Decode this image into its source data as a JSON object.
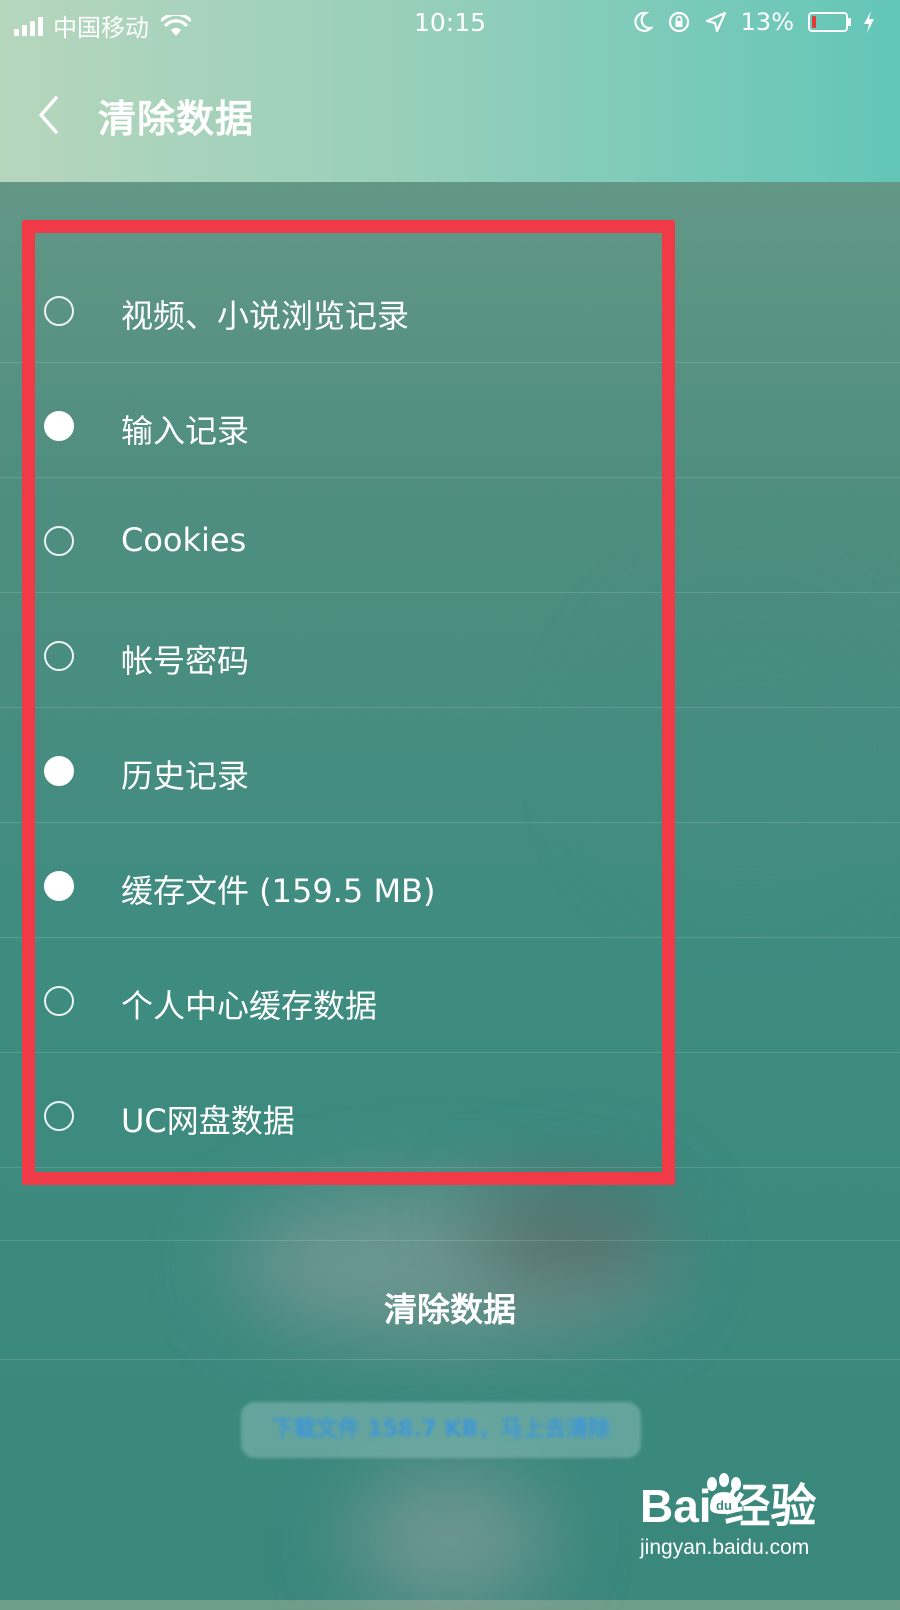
{
  "status_bar": {
    "carrier": "中国移动",
    "time": "10:15",
    "battery_percent": "13%",
    "battery_level": 0.13
  },
  "header": {
    "title": "清除数据"
  },
  "options": [
    {
      "label": "视频、小说浏览记录",
      "checked": false
    },
    {
      "label": "输入记录",
      "checked": true
    },
    {
      "label": "Cookies",
      "checked": false
    },
    {
      "label": "帐号密码",
      "checked": false
    },
    {
      "label": "历史记录",
      "checked": true
    },
    {
      "label": "缓存文件 (159.5 MB)",
      "checked": true
    },
    {
      "label": "个人中心缓存数据",
      "checked": false
    },
    {
      "label": "UC网盘数据",
      "checked": false
    }
  ],
  "actions": {
    "clear_label": "清除数据",
    "download_notice": "下载文件 158.7 KB，马上去清除"
  },
  "watermark": {
    "logo": "Bai  经验",
    "url": "jingyan.baidu.com"
  },
  "colors": {
    "highlight_border": "#f13a48",
    "battery_low": "#e03a3a",
    "notice_text": "#3f97d6"
  }
}
